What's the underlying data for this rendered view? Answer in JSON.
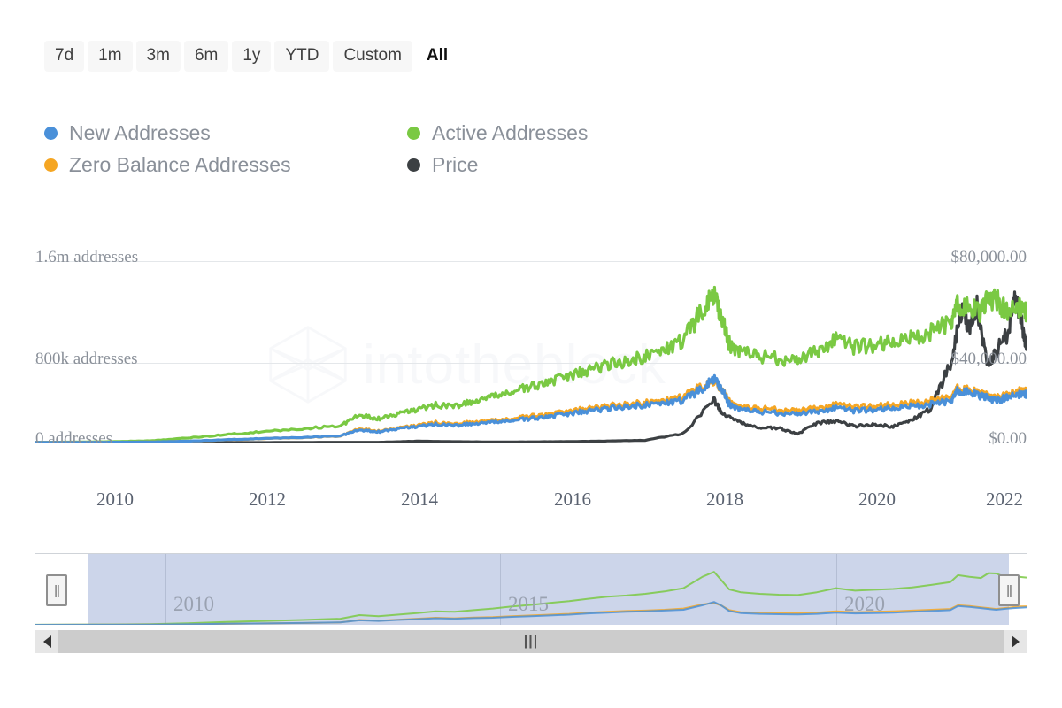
{
  "range_selector": {
    "buttons": [
      {
        "label": "7d",
        "active": false
      },
      {
        "label": "1m",
        "active": false
      },
      {
        "label": "3m",
        "active": false
      },
      {
        "label": "6m",
        "active": false
      },
      {
        "label": "1y",
        "active": false
      },
      {
        "label": "YTD",
        "active": false
      },
      {
        "label": "Custom",
        "active": false
      },
      {
        "label": "All",
        "active": true
      }
    ]
  },
  "legend": [
    {
      "label": "New Addresses",
      "color": "#4a90d9"
    },
    {
      "label": "Active Addresses",
      "color": "#7ac943"
    },
    {
      "label": "Zero Balance Addresses",
      "color": "#f5a623"
    },
    {
      "label": "Price",
      "color": "#3c4043"
    }
  ],
  "watermark": {
    "text": "intotheblock"
  },
  "navigator": {
    "years": [
      "2010",
      "2015",
      "2020"
    ],
    "left_handle_grip": "||",
    "right_handle_grip": "||",
    "scroll_grip": "|||",
    "left_arrow": "left-arrow",
    "right_arrow": "right-arrow"
  },
  "chart_data": {
    "type": "line",
    "title": "",
    "xlabel": "",
    "ylabel": "addresses",
    "y_left_axis": {
      "ticks": [
        "0 addresses",
        "800k addresses",
        "1.6m addresses"
      ],
      "values": [
        0,
        800000,
        1600000
      ],
      "min": 0,
      "max": 1600000
    },
    "y_right_axis": {
      "ticks": [
        "$0.00",
        "$40,000.00",
        "$80,000.00"
      ],
      "values": [
        0,
        40000,
        80000
      ],
      "min": 0,
      "max": 80000
    },
    "x_ticks": [
      "2010",
      "2012",
      "2014",
      "2016",
      "2018",
      "2020",
      "2022"
    ],
    "x_range": [
      "2009",
      "2022"
    ],
    "grid": true,
    "legend_position": "top-left",
    "series": [
      {
        "name": "New Addresses",
        "color": "#4a90d9",
        "axis": "left",
        "unit": "addresses",
        "x": [
          2009.0,
          2009.5,
          2010.0,
          2010.5,
          2011.0,
          2011.5,
          2012.0,
          2012.5,
          2013.0,
          2013.25,
          2013.5,
          2013.75,
          2014.0,
          2014.25,
          2014.5,
          2014.75,
          2015.0,
          2015.25,
          2015.5,
          2015.75,
          2016.0,
          2016.25,
          2016.5,
          2016.75,
          2017.0,
          2017.25,
          2017.5,
          2017.75,
          2017.9,
          2018.0,
          2018.1,
          2018.25,
          2018.5,
          2018.75,
          2019.0,
          2019.25,
          2019.5,
          2019.75,
          2020.0,
          2020.25,
          2020.5,
          2020.75,
          2021.0,
          2021.1,
          2021.25,
          2021.4,
          2021.5,
          2021.6,
          2021.75,
          2021.9,
          2022.0
        ],
        "y": [
          1000,
          1500,
          3000,
          5000,
          12000,
          25000,
          35000,
          45000,
          60000,
          110000,
          95000,
          120000,
          140000,
          160000,
          150000,
          165000,
          175000,
          195000,
          210000,
          230000,
          250000,
          280000,
          300000,
          320000,
          330000,
          350000,
          370000,
          480000,
          560000,
          470000,
          340000,
          290000,
          270000,
          260000,
          255000,
          270000,
          300000,
          280000,
          290000,
          300000,
          320000,
          340000,
          360000,
          460000,
          440000,
          410000,
          390000,
          370000,
          400000,
          420000,
          430000
        ]
      },
      {
        "name": "Active Addresses",
        "color": "#7ac943",
        "axis": "left",
        "unit": "addresses",
        "x": [
          2009.0,
          2009.5,
          2010.0,
          2010.5,
          2011.0,
          2011.5,
          2012.0,
          2012.5,
          2013.0,
          2013.25,
          2013.5,
          2013.75,
          2014.0,
          2014.25,
          2014.5,
          2014.75,
          2015.0,
          2015.25,
          2015.5,
          2015.75,
          2016.0,
          2016.25,
          2016.5,
          2016.75,
          2017.0,
          2017.25,
          2017.5,
          2017.75,
          2017.9,
          2018.0,
          2018.1,
          2018.25,
          2018.5,
          2018.75,
          2019.0,
          2019.25,
          2019.5,
          2019.75,
          2020.0,
          2020.25,
          2020.5,
          2020.75,
          2021.0,
          2021.1,
          2021.25,
          2021.4,
          2021.5,
          2021.6,
          2021.75,
          2021.9,
          2022.0
        ],
        "y": [
          2000,
          4000,
          8000,
          15000,
          40000,
          70000,
          95000,
          120000,
          150000,
          240000,
          210000,
          250000,
          290000,
          330000,
          320000,
          360000,
          400000,
          450000,
          490000,
          540000,
          580000,
          640000,
          690000,
          720000,
          760000,
          820000,
          900000,
          1180000,
          1300000,
          1090000,
          870000,
          800000,
          760000,
          740000,
          730000,
          800000,
          900000,
          840000,
          860000,
          880000,
          920000,
          980000,
          1050000,
          1220000,
          1180000,
          1150000,
          1270000,
          1260000,
          1150000,
          1180000,
          1160000
        ]
      },
      {
        "name": "Zero Balance Addresses",
        "color": "#f5a623",
        "axis": "left",
        "unit": "addresses",
        "x": [
          2009.0,
          2009.5,
          2010.0,
          2010.5,
          2011.0,
          2011.5,
          2012.0,
          2012.5,
          2013.0,
          2013.25,
          2013.5,
          2013.75,
          2014.0,
          2014.25,
          2014.5,
          2014.75,
          2015.0,
          2015.25,
          2015.5,
          2015.75,
          2016.0,
          2016.25,
          2016.5,
          2016.75,
          2017.0,
          2017.25,
          2017.5,
          2017.75,
          2017.9,
          2018.0,
          2018.1,
          2018.25,
          2018.5,
          2018.75,
          2019.0,
          2019.25,
          2019.5,
          2019.75,
          2020.0,
          2020.25,
          2020.5,
          2020.75,
          2021.0,
          2021.1,
          2021.25,
          2021.4,
          2021.5,
          2021.6,
          2021.75,
          2021.9,
          2022.0
        ],
        "y": [
          800,
          1200,
          2500,
          4500,
          11000,
          24000,
          34000,
          44000,
          58000,
          120000,
          100000,
          125000,
          150000,
          175000,
          160000,
          180000,
          190000,
          210000,
          230000,
          250000,
          270000,
          300000,
          320000,
          340000,
          350000,
          370000,
          400000,
          500000,
          540000,
          470000,
          360000,
          310000,
          300000,
          290000,
          285000,
          300000,
          330000,
          310000,
          320000,
          330000,
          350000,
          370000,
          390000,
          480000,
          460000,
          430000,
          410000,
          390000,
          420000,
          450000,
          455000
        ]
      },
      {
        "name": "Price",
        "color": "#3c4043",
        "axis": "right",
        "unit": "USD",
        "x": [
          2009.0,
          2010.0,
          2011.0,
          2012.0,
          2013.0,
          2013.5,
          2014.0,
          2014.5,
          2015.0,
          2015.5,
          2016.0,
          2016.5,
          2017.0,
          2017.5,
          2017.9,
          2018.0,
          2018.25,
          2018.5,
          2018.75,
          2019.0,
          2019.25,
          2019.5,
          2019.75,
          2020.0,
          2020.25,
          2020.5,
          2020.75,
          2021.0,
          2021.15,
          2021.25,
          2021.35,
          2021.5,
          2021.6,
          2021.75,
          2021.85,
          2021.95,
          2022.0
        ],
        "y": [
          0,
          0,
          5,
          10,
          130,
          100,
          600,
          400,
          250,
          300,
          450,
          650,
          1000,
          4000,
          19000,
          13000,
          8500,
          6500,
          6300,
          3800,
          8500,
          9500,
          7200,
          8000,
          7000,
          10000,
          15000,
          35000,
          58000,
          50000,
          60000,
          33000,
          40000,
          48000,
          65000,
          50000,
          42000
        ]
      }
    ]
  }
}
